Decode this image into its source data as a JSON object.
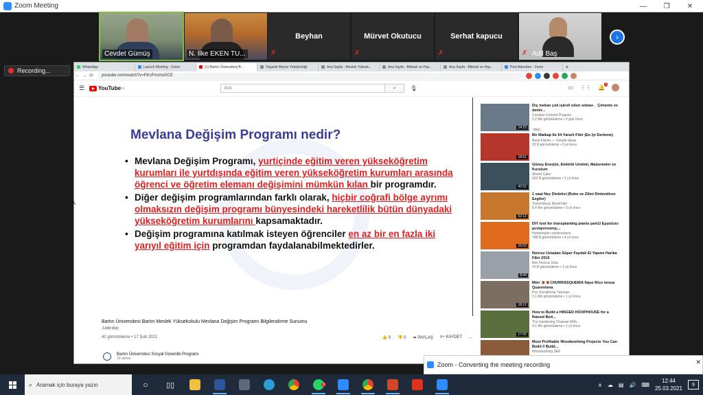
{
  "zoom": {
    "title": "Zoom Meeting",
    "recording_label": "Recording...",
    "participants": [
      {
        "name": "Cevdet Gümüş",
        "video": true
      },
      {
        "name": "N. İlke EKEN TU...",
        "video": true
      },
      {
        "name": "Beyhan",
        "video": false
      },
      {
        "name": "Mürvet Okutucu",
        "video": false
      },
      {
        "name": "Serhat  kapucu",
        "video": false
      },
      {
        "name": "Adil Baş",
        "video": true
      }
    ],
    "toast": "Zoom - Converting the meeting recording"
  },
  "browser": {
    "tabs": [
      {
        "label": "WhatsApp",
        "color": "#25d366"
      },
      {
        "label": "Launch Meeting - Zoom",
        "color": "#2d8cff"
      },
      {
        "label": "(1) Bartın Üniversitesi B...",
        "color": "#ff0000"
      },
      {
        "label": "Organik Meyve Yetiştiriciliği",
        "color": "#888888"
      },
      {
        "label": "Ana Sayfa - Meslek Yüksek...",
        "color": "#888888"
      },
      {
        "label": "Ana Sayfa - Bitkisel ve Hay...",
        "color": "#888888"
      },
      {
        "label": "Ana Sayfa - Bitkisel ve Hay...",
        "color": "#888888"
      },
      {
        "label": "Post Attendee - Zoom",
        "color": "#2d8cff"
      }
    ],
    "new_tab": "+",
    "url": "youtube.com/watch?v=PKsFmchoGCE"
  },
  "youtube": {
    "logo": "YouTube",
    "logo_sup": "TR",
    "search_placeholder": "Ara",
    "notification_count": "1"
  },
  "slide": {
    "title": "Mevlana Değişim Programı nedir?",
    "bullets": [
      {
        "parts": [
          {
            "t": "Mevlana Değişim Programı, ",
            "red": false
          },
          {
            "t": "yurtiçinde eğitim veren yükseköğretim kurumları ile yurtdışında eğitim veren yükseköğretim kurumları arasında öğrenci ve öğretim elemanı değişimini mümkün kılan ",
            "red": true
          },
          {
            "t": "bir programdır.",
            "red": false
          }
        ]
      },
      {
        "parts": [
          {
            "t": "Diğer değişim programlarından farklı olarak, ",
            "red": false
          },
          {
            "t": "hiçbir coğrafi bölge ayrımı olmaksızın değişim programı bünyesindeki hareketlilik bütün dünyadaki yükseköğretim kurumlarını ",
            "red": true
          },
          {
            "t": "kapsamaktadır.",
            "red": false
          }
        ]
      },
      {
        "parts": [
          {
            "t": "Değişim programına katılmak isteyen öğrenciler ",
            "red": false
          },
          {
            "t": "en az bir en fazla iki yarıyıl eğitim için",
            "red": true
          },
          {
            "t": " programdan faydalanabilmektedirler.",
            "red": false
          }
        ]
      }
    ]
  },
  "video": {
    "title": "Bartın Üniversitesi Bartın Meslek Yüksekokulu Mevlana Değişim Programı Bilgilendirme Sunumu",
    "tag": "Liste dışı",
    "views_date": "42 görüntüleme • 17 Şub 2021",
    "likes": "0",
    "dislikes": "0",
    "share": "PAYLAŞ",
    "save": "KAYDET",
    "more": "...",
    "channel_name": "Bartın Üniversitesi Sosyal Güvenlik Programı",
    "channel_subs": "19 abone"
  },
  "recommendations": [
    {
      "title": "Dış mekan çok işlevli odun sobası _ Çimento ve demir...",
      "channel": "Creative Cement Projects",
      "views": "5,2 Mn görüntüleme • 5 gün önce",
      "duration": "14:15",
      "new": "Yeni",
      "thumb": "#6a7a8a"
    },
    {
      "title": "Bir Matkap İle 54 Yararlı Fikir (En İyi Derleme)",
      "channel": "Basit Fikirler — Simple Ideas",
      "views": "33 B görüntüleme • 3 yıl önce",
      "duration": "18:51",
      "new": "",
      "thumb": "#b5362a"
    },
    {
      "title": "Güneş Enerjisi, Elektrik Üretimi, Malzemeler ve Kurulum",
      "channel": "Ahmet Çakır",
      "views": "602 B görüntüleme • 1 yıl önce",
      "duration": "42:52",
      "new": "",
      "thumb": "#3b4f5c"
    },
    {
      "title": "1 saat Ney Dinletisi (Ruhu ve Zihni Dinlendiren Ezgiler)",
      "channel": "Trend Music World Net",
      "views": "8,4 Mn görüntüleme • 3 yıl önce",
      "duration": "52:12",
      "new": "",
      "thumb": "#c7782e"
    },
    {
      "title": "DIY tool for transplanting plants part1/ Εργαλείο μεταφυτευσης...",
      "channel": "Homemade constructions",
      "views": "788 B görüntüleme • 4 yıl önce",
      "duration": "15:52",
      "new": "",
      "thumb": "#e06a1e"
    },
    {
      "title": "Novruz Ustadan Süper Faydalı El Yapımı Harika Fikir 2019",
      "channel": "Ben Novruz Usta",
      "views": "15 B görüntüleme • 1 yıl önce",
      "duration": "8:44",
      "new": "",
      "thumb": "#9aa0a8"
    },
    {
      "title": "Mini 🐌🐌CHURRASQUEIRA fique Rico nessa Quarentena",
      "channel": "Pox Serralheria Tutoriais",
      "views": "2,1 Mn görüntüleme • 1 yıl önce",
      "duration": "18:12",
      "new": "",
      "thumb": "#7c6f62"
    },
    {
      "title": "How to Build a HINGED HOOPHOUSE for a Raised Bed...",
      "channel": "The Gardening Channel With...",
      "views": "4,1 Mn görüntüleme • 1 yıl önce",
      "duration": "17:02",
      "new": "",
      "thumb": "#5a6e3e"
    },
    {
      "title": "Most Profitable Woodworking Projects You Can Build // Build...",
      "channel": "Woodworking Skill",
      "views": "",
      "duration": "",
      "new": "",
      "thumb": "#8a5a3a"
    }
  ],
  "taskbar": {
    "search_placeholder": "Aramak için buraya yazın",
    "time": "12:44",
    "date": "25.03.2021",
    "notifications": "9",
    "whatsapp_badge": "3"
  }
}
